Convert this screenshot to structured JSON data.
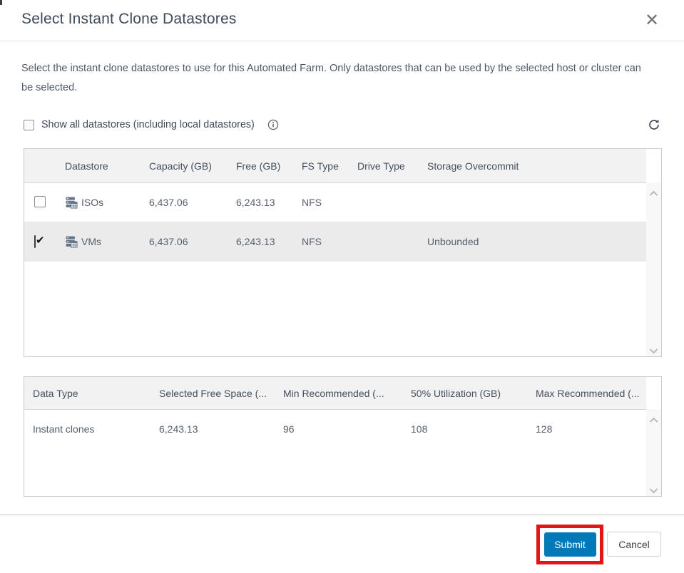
{
  "dialog": {
    "title": "Select Instant Clone Datastores",
    "close_glyph": "✕",
    "description": "Select the instant clone datastores to use for this Automated Farm. Only datastores that can be used by the selected host or cluster can be selected."
  },
  "controls": {
    "show_all_label": "Show all datastores (including local datastores)",
    "show_all_checked": false,
    "info_icon": "info-circle",
    "refresh_icon": "refresh"
  },
  "datastore_table": {
    "columns": [
      "Datastore",
      "Capacity (GB)",
      "Free (GB)",
      "FS Type",
      "Drive Type",
      "Storage Overcommit"
    ],
    "rows": [
      {
        "checked": false,
        "check_glyph": "",
        "name": "ISOs",
        "capacity": "6,437.06",
        "free": "6,243.13",
        "fs_type": "NFS",
        "drive_type": "",
        "storage_overcommit": "",
        "selected": false
      },
      {
        "checked": true,
        "check_glyph": "✔",
        "name": "VMs",
        "capacity": "6,437.06",
        "free": "6,243.13",
        "fs_type": "NFS",
        "drive_type": "",
        "storage_overcommit": "Unbounded",
        "selected": true
      }
    ]
  },
  "recommendation_table": {
    "columns": [
      "Data Type",
      "Selected Free Space (...",
      "Min Recommended (...",
      "50% Utilization (GB)",
      "Max Recommended (..."
    ],
    "rows": [
      {
        "data_type": "Instant clones",
        "selected_free_space": "6,243.13",
        "min_recommended": "96",
        "utilization_50": "108",
        "max_recommended": "128"
      }
    ]
  },
  "footer": {
    "submit_label": "Submit",
    "cancel_label": "Cancel",
    "submit_highlighted": true
  },
  "colors": {
    "accent_blue": "#0079b8",
    "annotation_red": "#e1161b",
    "title_text": "#3e4a5a",
    "selected_row_bg": "#ebebeb",
    "header_bg": "#f2f2f2"
  }
}
